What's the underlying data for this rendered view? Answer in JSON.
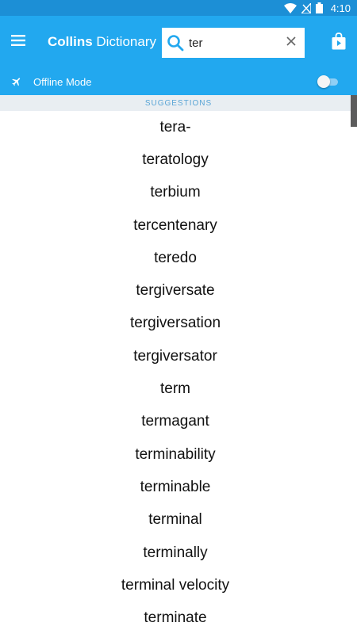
{
  "status_bar": {
    "time": "4:10"
  },
  "app_bar": {
    "title_bold": "Collins",
    "title_rest": " Dictionary",
    "search_value": "ter"
  },
  "offline": {
    "label": "Offline Mode",
    "enabled": false
  },
  "suggestions": {
    "header": "SUGGESTIONS",
    "items": [
      "tera-",
      "teratology",
      "terbium",
      "tercentenary",
      "teredo",
      "tergiversate",
      "tergiversation",
      "tergiversator",
      "term",
      "termagant",
      "terminability",
      "terminable",
      "terminal",
      "terminally",
      "terminal velocity",
      "terminate"
    ]
  },
  "colors": {
    "primary": "#22a8ef",
    "status": "#1c8fd6",
    "accent_text": "#5aa5d6"
  }
}
